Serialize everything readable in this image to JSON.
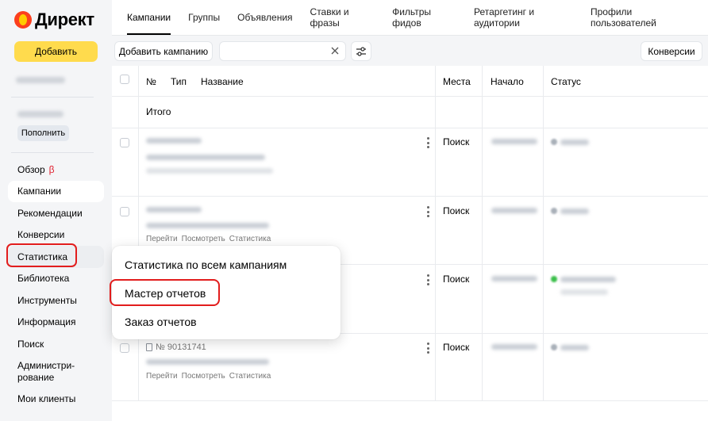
{
  "app": {
    "logo_text": "Директ",
    "add_button": "Добавить",
    "topup_button": "Пополнить"
  },
  "sidebar": {
    "items": [
      {
        "label": "Обзор",
        "badge": "β"
      },
      {
        "label": "Кампании"
      },
      {
        "label": "Рекомендации"
      },
      {
        "label": "Конверсии"
      },
      {
        "label": "Статистика"
      },
      {
        "label": "Библиотека"
      },
      {
        "label": "Инструменты"
      },
      {
        "label": "Информация"
      },
      {
        "label": "Поиск"
      },
      {
        "label": "Администри-\nрование"
      },
      {
        "label": "Мои клиенты"
      }
    ]
  },
  "tabs": [
    {
      "label": "Кампании",
      "active": true
    },
    {
      "label": "Группы"
    },
    {
      "label": "Объявления"
    },
    {
      "label": "Ставки и фразы"
    },
    {
      "label": "Фильтры фидов"
    },
    {
      "label": "Ретаргетинг и аудитории"
    },
    {
      "label": "Профили пользователей"
    }
  ],
  "toolbar": {
    "add_campaign": "Добавить кампанию",
    "search_value": "",
    "conversions": "Конверсии"
  },
  "table": {
    "headers": {
      "num": "№",
      "type": "Тип",
      "name": "Название",
      "places": "Места",
      "start": "Начало",
      "status": "Статус"
    },
    "total_label": "Итого",
    "rows": [
      {
        "places": "Поиск"
      },
      {
        "places": "Поиск",
        "links": [
          "Перейти",
          "Посмотреть",
          "Статистика"
        ]
      },
      {
        "places": "Поиск"
      },
      {
        "places": "Поиск",
        "id": "№ 90131741",
        "links": [
          "Перейти",
          "Посмотреть",
          "Статистика"
        ]
      }
    ]
  },
  "dropdown": {
    "items": [
      "Статистика по всем кампаниям",
      "Мастер отчетов",
      "Заказ отчетов"
    ]
  },
  "colors": {
    "accent_yellow": "#ffdb4d",
    "highlight_red": "#e21d1d",
    "sidebar_bg": "#f4f5f7"
  }
}
